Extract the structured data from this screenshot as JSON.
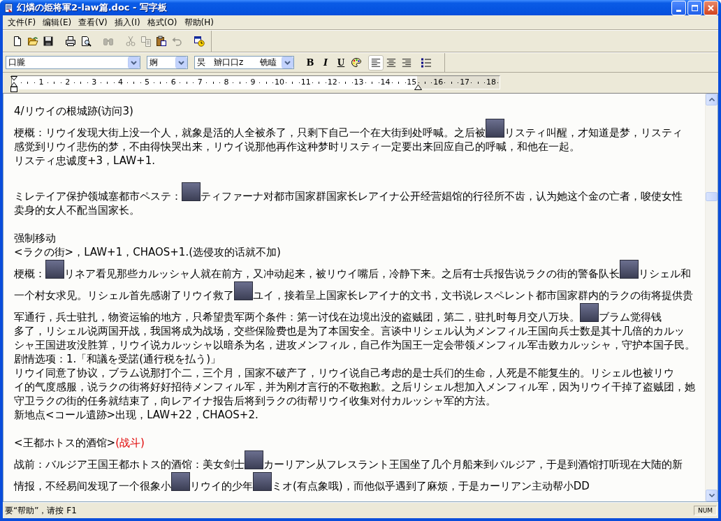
{
  "window": {
    "title": "幻燐の姫将軍2-law篇.doc - 写字板"
  },
  "menu": [
    "文件(F)",
    "编辑(E)",
    "查看(V)",
    "插入(I)",
    "格式(O)",
    "帮助(H)"
  ],
  "toolbar": [
    {
      "disabled": false
    },
    {
      "disabled": false
    },
    {
      "disabled": false
    },
    {
      "disabled": false
    },
    {
      "disabled": false
    },
    {
      "disabled": true
    },
    {
      "disabled": true
    },
    {
      "disabled": true
    },
    {
      "disabled": false
    },
    {
      "disabled": true
    },
    {
      "disabled": false
    }
  ],
  "format_bar": {
    "font": "口朧",
    "size": "婀",
    "script": "旲　辧口口z　　铣瞌",
    "bold": "B",
    "italic": "I",
    "underline": "U",
    "alignment": [
      {
        "selected": true
      },
      {
        "selected": false
      },
      {
        "selected": false
      }
    ]
  },
  "ruler": {
    "marks": [
      "1",
      "2",
      "3",
      "4",
      "5",
      "6",
      "7",
      "8",
      "9",
      "10",
      "11",
      "12",
      "13",
      "14",
      "15",
      "16",
      "17",
      "18"
    ]
  },
  "document": {
    "sections": [
      {
        "lines": [
          {
            "segments": [
              {
                "kind": "text",
                "text": "4/リウイの根城跡(访问3)"
              }
            ]
          },
          {
            "segments": [
              {
                "kind": "text",
                "text": "梗概：リウイ发现大街上没一个人，就象是活的人全被杀了，只剩下自己一个在大街到处呼喊。之后被"
              },
              {
                "kind": "portrait"
              },
              {
                "kind": "text",
                "text": "リスティ叫醒，才知道是梦，リスティ"
              }
            ]
          },
          {
            "segments": [
              {
                "kind": "text",
                "text": "感觉到リウイ悲伤的梦，不由得快哭出来，リウイ说那他再作这种梦时リスティ一定要出来回应自己的呼喊，和他在一起。"
              }
            ]
          },
          {
            "segments": [
              {
                "kind": "text",
                "text": "リスティ忠诚度+3，LAW+1."
              }
            ]
          }
        ]
      },
      {
        "lines": [
          {
            "segments": [
              {
                "kind": "text",
                "text": "ミレテイア保护领城塞都市ペステ："
              },
              {
                "kind": "portrait"
              },
              {
                "kind": "text",
                "text": "ティファーナ对都市国家群国家长レアイナ公开经营娼馆的行径所不齿，认为她这个金の亡者，唆使女性"
              }
            ]
          },
          {
            "segments": [
              {
                "kind": "text",
                "text": "卖身的女人不配当国家长。"
              }
            ]
          }
        ]
      },
      {
        "lines": [
          {
            "segments": [
              {
                "kind": "text",
                "text": "强制移动"
              }
            ]
          },
          {
            "segments": [
              {
                "kind": "text",
                "text": "<ラクの街>，LAW+1，CHAOS+1.(选侵攻的话就不加)"
              }
            ]
          },
          {
            "segments": [
              {
                "kind": "text",
                "text": "梗概："
              },
              {
                "kind": "portrait"
              },
              {
                "kind": "text",
                "text": "リネア看见那些カルッシャ人就在前方，又冲动起来，被リウイ嘴后，冷静下来。之后有士兵报告说ラクの街的警备队长"
              },
              {
                "kind": "portrait"
              },
              {
                "kind": "text",
                "text": "リシェル和"
              }
            ]
          },
          {
            "segments": [
              {
                "kind": "text",
                "text": "一个村女求见。リシェル首先感谢了リウイ救了"
              },
              {
                "kind": "portrait"
              },
              {
                "kind": "text",
                "text": "ユイ，接着呈上国家长レアイナ的文书，文书说レスペレント都市国家群内的ラクの街将提供贵"
              }
            ]
          },
          {
            "segments": [
              {
                "kind": "text",
                "text": "军通行，兵士驻扎，物资运输的地方，只希望贵军两个条件：第一讨伐在边境出没的盗贼团，第二，驻扎时每月交八万块。"
              },
              {
                "kind": "portrait"
              },
              {
                "kind": "text",
                "text": "ブラム觉得钱"
              }
            ]
          },
          {
            "segments": [
              {
                "kind": "text",
                "text": "多了，リシェル说两国开战，我国将成为战场，交些保险费也是为了本国安全。言谈中リシェル认为メンフィル王国向兵士数是其十几倍的カルッ"
              }
            ]
          },
          {
            "segments": [
              {
                "kind": "text",
                "text": "シャ王国进攻没胜算，リウイ说カルッシャ以暗杀为名，进攻メンフィル，自己作为国王一定会带领メンフィル军击败カルッシャ，守护本国子民。"
              }
            ]
          },
          {
            "segments": [
              {
                "kind": "text",
                "text": "剧情选项：1.「和議を受諾(通行税を払う)」"
              }
            ]
          },
          {
            "segments": [
              {
                "kind": "text",
                "text": "リウイ同意了协议，ブラム说那打个二，三个月，国家不破产了，リウイ说自己考虑的是士兵们的生命，人死是不能复生的。リシェル也被リウ"
              }
            ]
          },
          {
            "segments": [
              {
                "kind": "text",
                "text": "イ的气度感服，说ラクの街将好好招待メンフィル军，并为刚才言行的不敬抱歉。之后リシェル想加入メンフィル军，因为リウイ干掉了盗贼团，她"
              }
            ]
          },
          {
            "segments": [
              {
                "kind": "text",
                "text": "守卫ラクの街的任务就结束了，向レアイナ报告后将到ラクの街帮リウイ收集对付カルッシャ军的方法。"
              }
            ]
          },
          {
            "segments": [
              {
                "kind": "text",
                "text": "新地点<コール遺跡>出现，LAW+22，CHAOS+2."
              }
            ]
          }
        ]
      },
      {
        "lines": [
          {
            "segments": [
              {
                "kind": "text",
                "text": "<王都ホトス的酒馆>"
              },
              {
                "kind": "text",
                "text": "(战斗)",
                "color": "#e00000"
              }
            ]
          },
          {
            "segments": [
              {
                "kind": "text",
                "text": "战前：バルジア王国王都ホトス的酒馆：美女剑士"
              },
              {
                "kind": "portrait"
              },
              {
                "kind": "text",
                "text": "カーリアン从フレスラント王国坐了几个月船来到バルジア，于是到酒馆打听现在大陆的新"
              }
            ]
          },
          {
            "segments": [
              {
                "kind": "text",
                "text": "情报，不经易间发现了一个很象小"
              },
              {
                "kind": "portrait"
              },
              {
                "kind": "text",
                "text": "リウイ的少年"
              },
              {
                "kind": "portrait"
              },
              {
                "kind": "text",
                "text": "ミオ(有点象哦)，而他似乎遇到了麻烦，于是カーリアン主动帮小DD"
              }
            ]
          }
        ]
      }
    ]
  },
  "status_bar": {
    "help": "要“帮助”，请按 F1",
    "indicator": "NUM"
  }
}
